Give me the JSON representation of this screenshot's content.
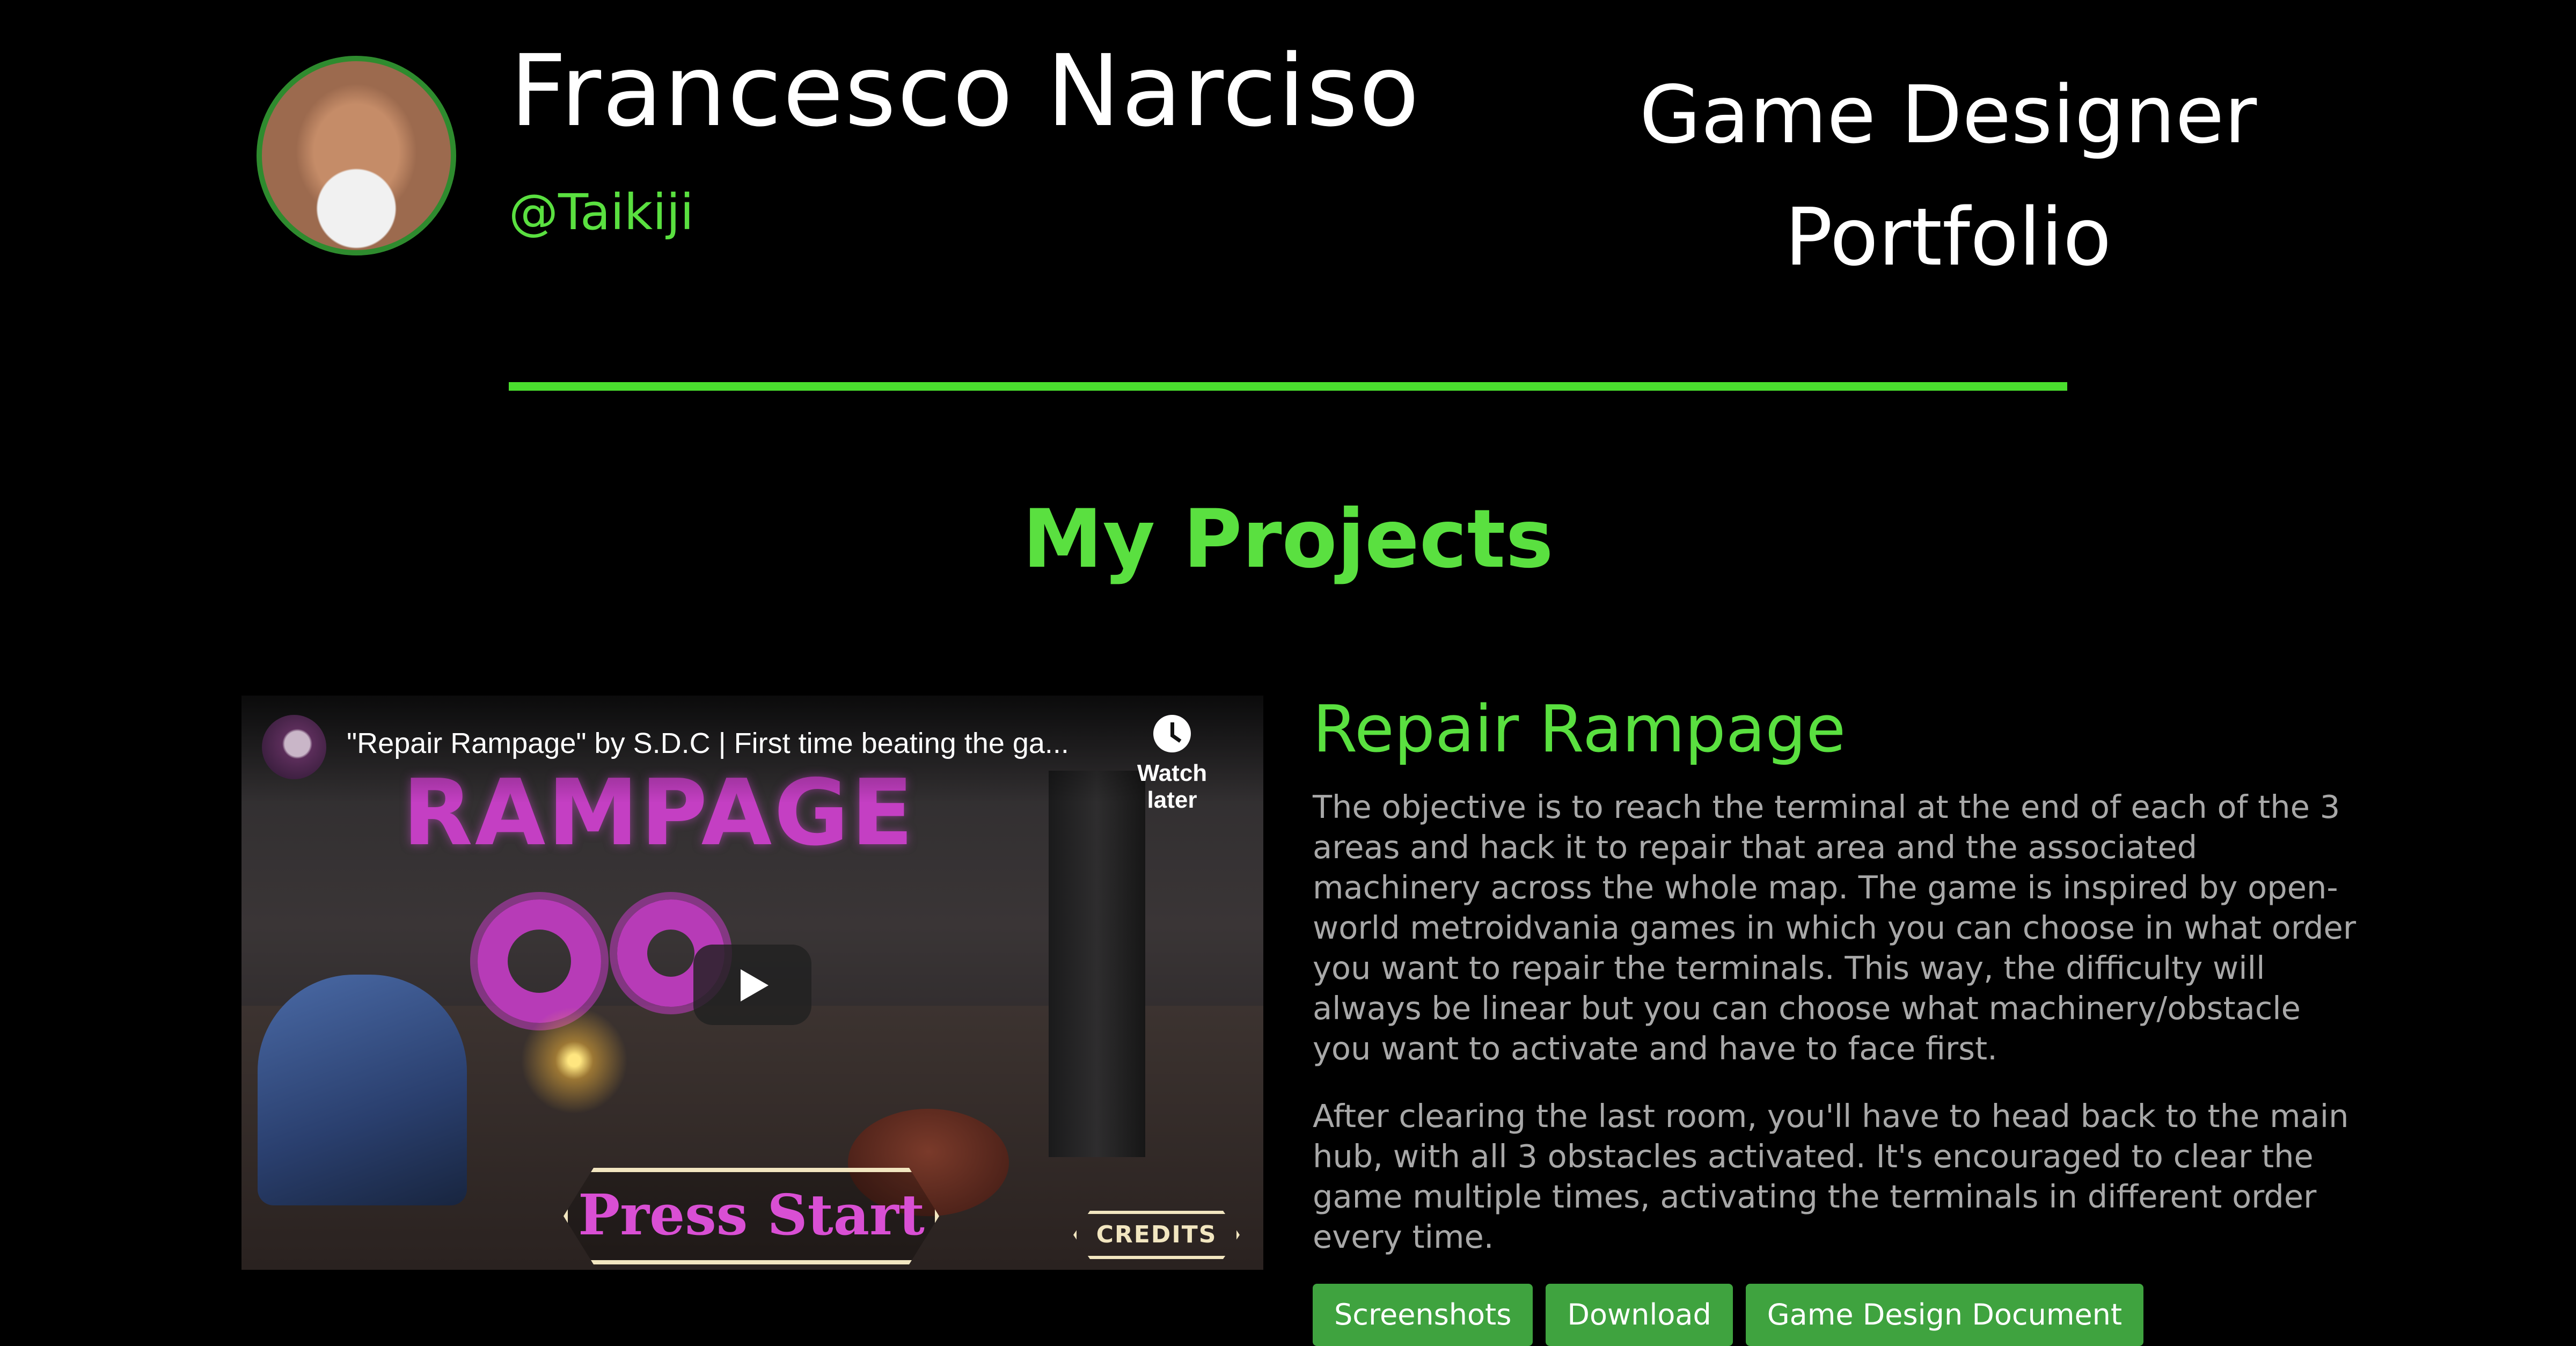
{
  "header": {
    "name": "Francesco Narciso",
    "handle": "@Taikiji",
    "tagline_line1": "Game Designer",
    "tagline_line2": "Portfolio"
  },
  "section": {
    "title": "My Projects"
  },
  "project": {
    "video": {
      "title": "\"Repair Rampage\" by S.D.C | First time beating the ga...",
      "watch_later_label": "Watch later",
      "thumbnail_logo": "RAMPAGE",
      "thumbnail_press_start": "Press Start",
      "thumbnail_credits": "CREDITS"
    },
    "title": "Repair Rampage",
    "description_1": "The objective is to reach the terminal at the end of each of the 3 areas and hack it to repair that area and the associated machinery across the whole map. The game is inspired by open-world metroidvania games in which you can choose in what order you want to repair the terminals. This way, the difficulty will always be linear but you can choose what machinery/obstacle you want to activate and have to face first.",
    "description_2": "After clearing the last room, you'll have to head back to the main hub, with all 3 obstacles activated. It's encouraged to clear the game multiple times, activating the terminals in different order every time.",
    "buttons": {
      "screenshots": "Screenshots",
      "download": "Download",
      "gdd": "Game Design Document"
    }
  },
  "colors": {
    "accent_green": "#5ae040",
    "button_green": "#3fa33f",
    "background": "#000000",
    "body_text": "#a8a8a8"
  },
  "icons": {
    "play": "play-icon",
    "watch_later": "clock-icon"
  }
}
